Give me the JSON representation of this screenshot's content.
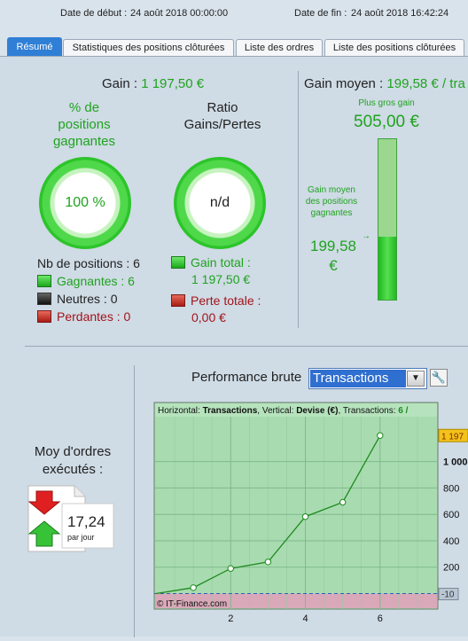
{
  "header": {
    "start_label": "Date de début :",
    "start_value": "24 août 2018 00:00:00",
    "end_label": "Date de fin :",
    "end_value": "24 août 2018 16:42:24"
  },
  "tabs": [
    {
      "label": "Résumé",
      "active": true
    },
    {
      "label": "Statistiques des positions clôturées",
      "active": false
    },
    {
      "label": "Liste des ordres",
      "active": false
    },
    {
      "label": "Liste des positions clôturées",
      "active": false
    }
  ],
  "summary": {
    "gain_label": "Gain : ",
    "gain_value": "1 197,50 €",
    "pct_title": "% de positions gagnantes",
    "pct_value": "100 %",
    "ratio_title": "Ratio Gains/Pertes",
    "ratio_value": "n/d",
    "nb_positions": "Nb de positions : 6",
    "gagnantes": "Gagnantes : 6",
    "neutres": "Neutres : 0",
    "perdantes": "Perdantes : 0",
    "gain_total_label": "Gain total :",
    "gain_total_value": "1 197,50 €",
    "perte_totale_label": "Perte totale :",
    "perte_totale_value": "0,00 €"
  },
  "gain_moyen": {
    "title_label": "Gain moyen : ",
    "title_value": "199,58 € / tra",
    "plus_gros_label": "Plus gros gain",
    "plus_gros_value": "505,00 €",
    "bar_label": "Gain moyen des positions gagnantes",
    "bar_value_line1": "199,58",
    "bar_value_line2": "€",
    "bar_fill_fraction": 0.395
  },
  "moy_ordres": {
    "title_line1": "Moy d'ordres",
    "title_line2": "exécutés :",
    "value": "17,24",
    "unit": "par jour"
  },
  "performance": {
    "label": "Performance brute",
    "selected": "Transactions"
  },
  "colors": {
    "accent": "#2f7fd6",
    "green": "#1fa31f",
    "red": "#a3141a"
  },
  "chart_data": {
    "type": "line",
    "header_prefix": "Horizontal: ",
    "header_x": "Transactions",
    "header_mid": ", Vertical: ",
    "header_y": "Devise (€)",
    "header_suffix": ", Transactions: ",
    "header_count": "6 /",
    "x": [
      0,
      1,
      2,
      3,
      4,
      5,
      6
    ],
    "y": [
      0,
      45,
      190,
      240,
      583,
      692,
      1197.5
    ],
    "xlim": [
      0,
      7.5
    ],
    "ylim": [
      -10,
      1300
    ],
    "x_ticks": [
      "2",
      "4",
      "6"
    ],
    "x_tick_values": [
      2,
      4,
      6
    ],
    "y_ticks": [
      "1 000",
      "800",
      "600",
      "400",
      "200"
    ],
    "y_tick_values": [
      1000,
      800,
      600,
      400,
      200
    ],
    "last_value_label": "1 197",
    "baseline_label": "-10",
    "watermark": "© IT-Finance.com",
    "grid": true
  }
}
